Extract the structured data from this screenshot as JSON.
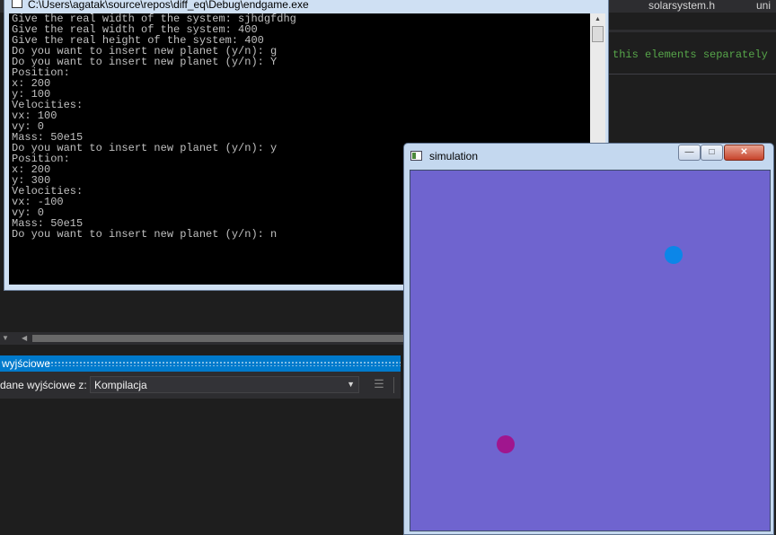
{
  "ide": {
    "tabs": [
      "solarsystem.h",
      "uni"
    ],
    "code_comment": "this elements separately",
    "output_panel": {
      "title": "wyjściowe",
      "show_output_from_label": "dane wyjściowe z:",
      "show_output_from_value": "Kompilacja"
    }
  },
  "console": {
    "title": "C:\\Users\\agatak\\source\\repos\\diff_eq\\Debug\\endgame.exe",
    "lines": [
      "Give the real width of the system: sjhdgfdhg",
      "Give the real width of the system: 400",
      "Give the real height of the system: 400",
      "Do you want to insert new planet (y/n): g",
      "Do you want to insert new planet (y/n): Y",
      "Position:",
      "x: 200",
      "y: 100",
      "Velocities:",
      "vx: 100",
      "vy: 0",
      "Mass: 50e15",
      "Do you want to insert new planet (y/n): y",
      "Position:",
      "x: 200",
      "y: 300",
      "Velocities:",
      "vx: -100",
      "vy: 0",
      "Mass: 50e15",
      "Do you want to insert new planet (y/n): n"
    ],
    "text_color": "#c0c0c0",
    "background_color": "#000000"
  },
  "simulation": {
    "title": "simulation",
    "background_color": "#6f64cf",
    "planets": [
      {
        "name": "planet-1",
        "color": "#0b86e8"
      },
      {
        "name": "planet-2",
        "color": "#a0168e"
      }
    ]
  },
  "colors": {
    "ide_accent": "#007acc",
    "ide_background": "#1e1e1e"
  }
}
